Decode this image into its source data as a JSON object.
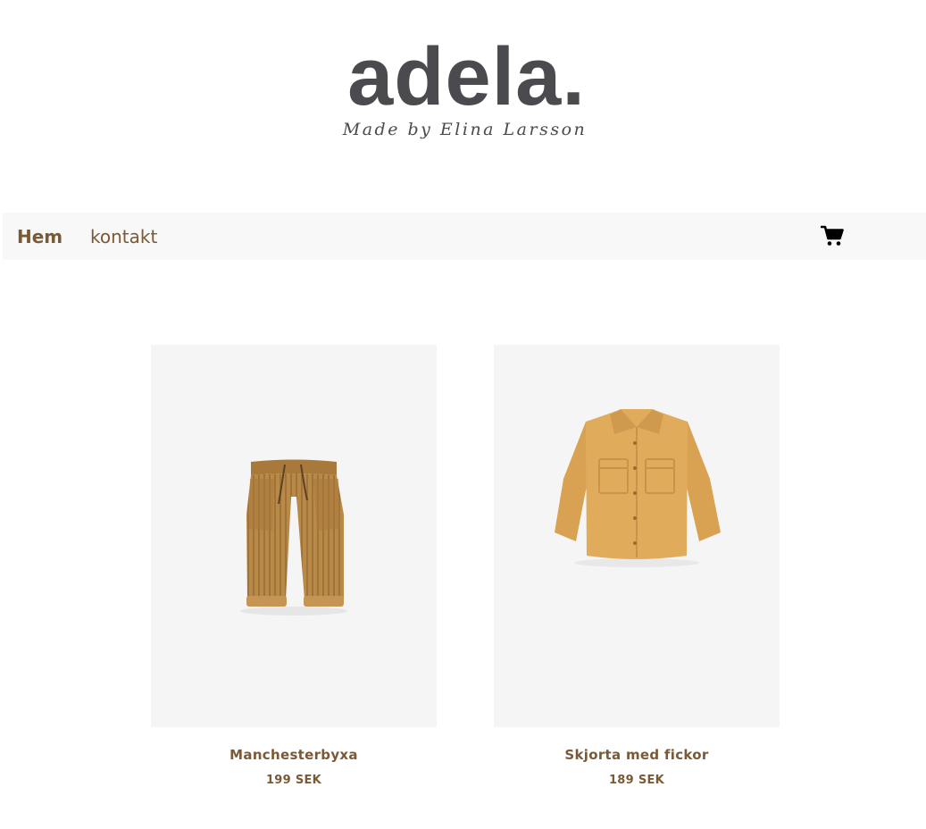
{
  "logo": {
    "wordmark": "adela.",
    "tagline": "Made by Elina Larsson"
  },
  "nav": {
    "items": [
      {
        "label": "Hem"
      },
      {
        "label": "kontakt"
      }
    ],
    "cart_icon": "shopping-cart-icon"
  },
  "products": [
    {
      "name": "Manchesterbyxa",
      "price": "199 SEK",
      "image": "corduroy-pants"
    },
    {
      "name": "Skjorta med fickor",
      "price": "189 SEK",
      "image": "shirt-with-pockets"
    }
  ],
  "colors": {
    "accent": "#7a5a36",
    "logo": "#4a4a4f",
    "navbar_bg": "#f8f8f8",
    "image_bg": "#f5f5f5",
    "pants": "#b98a47",
    "shirt": "#e0ac5c"
  }
}
